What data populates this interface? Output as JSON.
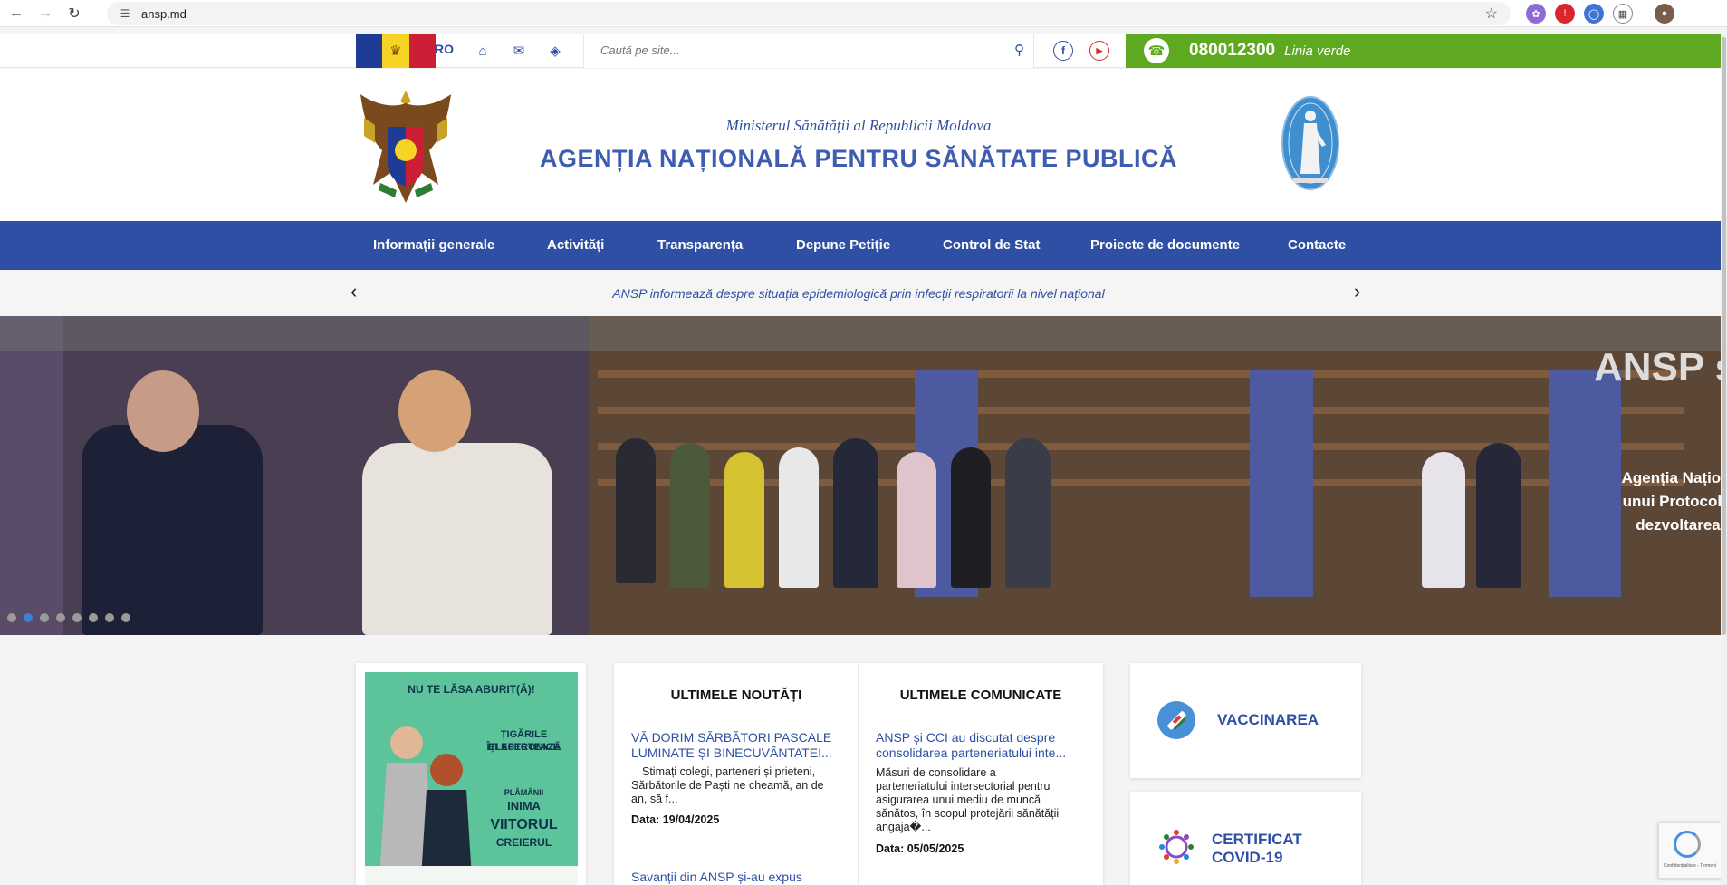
{
  "browser": {
    "url": "ansp.md",
    "back_icon": "arrow-left-icon",
    "forward_icon": "arrow-right-icon",
    "reload_icon": "reload-icon"
  },
  "topbar": {
    "language": "RO",
    "search_placeholder": "Caută pe site...",
    "phone": "080012300",
    "phone_label": "Linia verde"
  },
  "header": {
    "ministry": "Ministerul Sănătății al Republicii Moldova",
    "agency": "AGENȚIA NAȚIONALĂ PENTRU SĂNĂTATE PUBLICĂ"
  },
  "menu": {
    "items": [
      {
        "label": "Informații generale"
      },
      {
        "label": "Activități"
      },
      {
        "label": "Transparența"
      },
      {
        "label": "Depune Petiție"
      },
      {
        "label": "Control de Stat"
      },
      {
        "label": "Proiecte de documente"
      },
      {
        "label": "Contacte"
      }
    ]
  },
  "ticker": {
    "text": "ANSP informează despre situația epidemiologică prin infecții respiratorii la nivel național"
  },
  "hero": {
    "title": "ANSP ș",
    "caption_lines": [
      "Agenția Națională per",
      "unui Protocol de cola",
      "dezvoltarea relații"
    ],
    "slide_count": 8,
    "active_slide": 2
  },
  "poster": {
    "title": "NU TE LĂSA ABURIT(Ă)!",
    "subtitle_1": "ȚIGĂRILE ELECTRONICE",
    "subtitle_2": "ÎȚI AFECTEAZĂ",
    "word_1": "PLĂMÂNII",
    "word_2": "INIMA",
    "word_3": "VIITORUL",
    "word_4": "CREIERUL"
  },
  "news": {
    "title": "ULTIMELE NOUTĂȚI",
    "items": [
      {
        "link_line1": "VĂ DORIM SĂRBĂTORI PASCALE",
        "link_line2": "LUMINATE ȘI BINECUVÂNTATE!...",
        "excerpt_line1": "Stimați colegi, parteneri și prieteni,",
        "excerpt_line2": "Sărbătorile de Paști ne cheamă, an de",
        "excerpt_line3": "an, să f...",
        "date": "Data: 19/04/2025"
      },
      {
        "link_line1": "Savanții din ANSP și-au expus"
      }
    ]
  },
  "communicates": {
    "title": "ULTIMELE COMUNICATE",
    "items": [
      {
        "link_line1": "ANSP și CCI au discutat despre",
        "link_line2": "consolidarea parteneriatului inte...",
        "excerpt_line1": "Măsuri de consolidare a",
        "excerpt_line2": "parteneriatului intersectorial pentru",
        "excerpt_line3": "asigurarea unui mediu de muncă",
        "excerpt_line4": "sănătos, în scopul protejării sănătății",
        "excerpt_line5": "angaja�...",
        "date": "Data: 05/05/2025"
      }
    ]
  },
  "side": {
    "vaccination": "VACCINAREA",
    "certificate_line1": "CERTIFICAT",
    "certificate_line2": "COVID-19"
  },
  "recaptcha": {
    "text": "Confidențialitate - Termeni"
  },
  "colors": {
    "primary": "#2e4fa3",
    "green": "#5ea91f",
    "header_bg": "#ffffff"
  }
}
